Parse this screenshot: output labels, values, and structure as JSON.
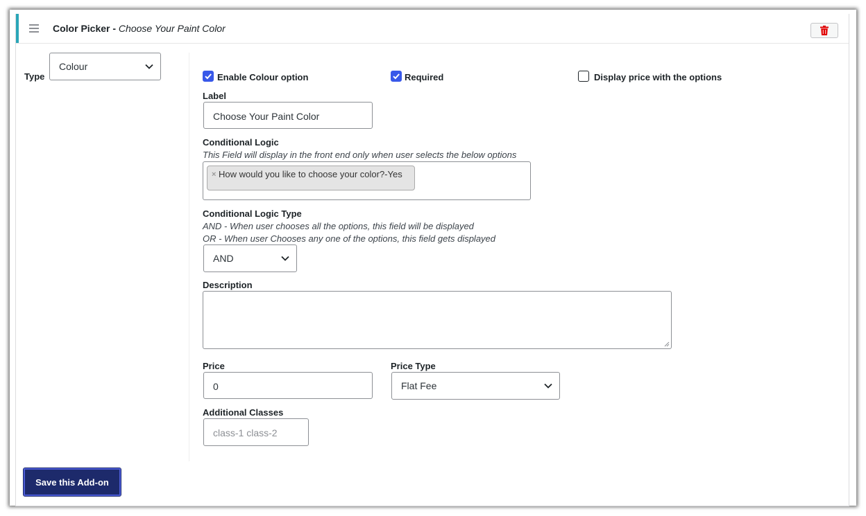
{
  "header": {
    "field_type": "Color Picker -",
    "field_name": "Choose Your Paint Color",
    "menu_icon": "hamburger-icon",
    "delete_icon": "trash-icon",
    "delete_icon_color": "#e00000",
    "accent_color": "#2aa6b8"
  },
  "sidebar": {
    "type_label": "Type",
    "type_value": "Colour"
  },
  "options": {
    "enable_label": "Enable Colour option",
    "enable_checked": true,
    "required_label": "Required",
    "required_checked": true,
    "display_price_label": "Display price with the options",
    "display_price_checked": false
  },
  "label_field": {
    "label": "Label",
    "value": "Choose Your Paint Color"
  },
  "conditional_logic": {
    "label": "Conditional Logic",
    "hint": "This Field will display in the front end only when user selects the below options",
    "selected": [
      "How would you like to choose your color?-Yes"
    ]
  },
  "conditional_logic_type": {
    "label": "Conditional Logic Type",
    "hint_and": "AND - When user chooses all the options, this field will be displayed",
    "hint_or": "OR - When user Chooses any one of the options, this field gets displayed",
    "value": "AND"
  },
  "description": {
    "label": "Description",
    "value": ""
  },
  "price": {
    "label": "Price",
    "value": "0"
  },
  "price_type": {
    "label": "Price Type",
    "value": "Flat Fee"
  },
  "additional_classes": {
    "label": "Additional Classes",
    "placeholder": "class-1 class-2"
  },
  "footer": {
    "save_label": "Save this Add-on",
    "save_color": "#1d2a6b"
  }
}
